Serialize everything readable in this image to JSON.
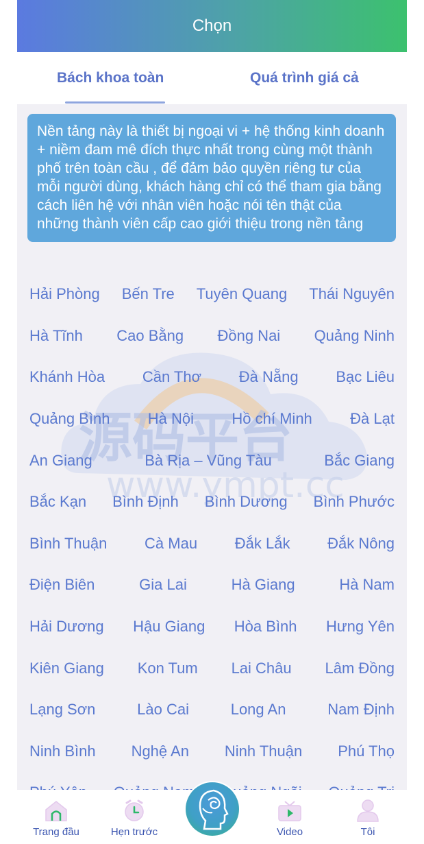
{
  "header": {
    "title": "Chọn"
  },
  "tabs": [
    {
      "label": "Bách khoa toàn"
    },
    {
      "label": "Quá trình giá cả"
    }
  ],
  "notice": {
    "text": "Nền tảng này là thiết bị ngoại vi + hệ thống kinh doanh + niềm đam mê đích thực nhất trong cùng một thành phố trên toàn cầu , để đảm bảo quyền riêng tư của mỗi người dùng, khách hàng chỉ có thể tham gia bằng cách liên hệ với nhân viên hoặc nói tên thật của những thành viên cấp cao giới thiệu trong nền tảng"
  },
  "watermark": {
    "cn": "源码平台",
    "url": "www.ympt.cc"
  },
  "cities": [
    [
      "Hải Phòng",
      "Bến Tre",
      "Tuyên Quang",
      "Thái Nguyên"
    ],
    [
      "Hà Tĩnh",
      "Cao Bằng",
      "Đồng Nai",
      "Quảng Ninh"
    ],
    [
      "Khánh Hòa",
      "Cần Thơ",
      "Đà Nẵng",
      "Bạc Liêu"
    ],
    [
      "Quảng Bình",
      "Hà Nội",
      "Hồ chí Minh",
      "Đà Lạt"
    ],
    [
      "An Giang",
      "Bà Rịa – Vũng Tàu",
      "Bắc Giang"
    ],
    [
      "Bắc Kạn",
      "Bình Định",
      "Bình Dương",
      "Bình Phước"
    ],
    [
      "Bình Thuận",
      "Cà Mau",
      "Đắk Lắk",
      "Đắk Nông"
    ],
    [
      "Điện Biên",
      "Gia Lai",
      "Hà Giang",
      "Hà Nam"
    ],
    [
      "Hải Dương",
      "Hậu Giang",
      "Hòa Bình",
      "Hưng Yên"
    ],
    [
      "Kiên Giang",
      "Kon Tum",
      "Lai Châu",
      "Lâm Đồng"
    ],
    [
      "Lạng Sơn",
      "Lào Cai",
      "Long An",
      "Nam Định"
    ],
    [
      "Ninh Bình",
      "Nghệ An",
      "Ninh Thuận",
      "Phú Thọ"
    ],
    [
      "Phú Yên",
      "Quảng Nam",
      "Quảng Ngãi",
      "Quảng Trị"
    ]
  ],
  "bottom_nav": [
    {
      "label": "Trang đầu",
      "icon": "home-icon"
    },
    {
      "label": "Hẹn trước",
      "icon": "clock-icon"
    },
    {
      "label": "Video",
      "icon": "video-icon"
    },
    {
      "label": "Tôi",
      "icon": "user-icon"
    }
  ],
  "center_button": {
    "icon": "face-logo-icon"
  },
  "colors": {
    "accent": "#5a79cf",
    "notice_bg": "#5fa7dc",
    "header_start": "#5b7ae0",
    "header_end": "#3cc16e"
  }
}
